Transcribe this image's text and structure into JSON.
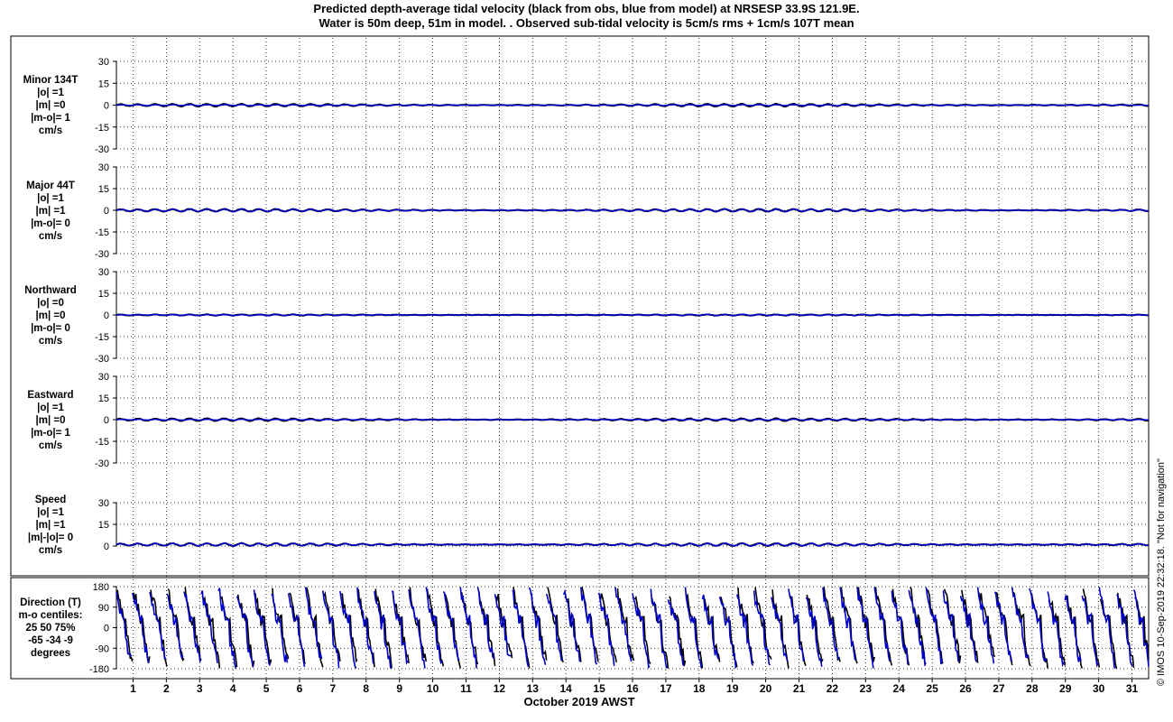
{
  "title_line1": "Predicted depth-average tidal velocity (black from obs, blue from model) at NRSESP 33.9S 121.9E.",
  "title_line2": "Water is 50m deep, 51m in model. . Observed sub-tidal velocity is 5cm/s rms + 1cm/s 107T mean",
  "x_axis_label": "October 2019 AWST",
  "footer": "© IMOS 10-Sep-2019 22:32:18.  \"Not for navigation\"",
  "colors": {
    "obs": "#000000",
    "model": "#0000cc",
    "grid": "#000000"
  },
  "chart_data": [
    {
      "type": "line",
      "panel": "minor",
      "label_lines": [
        "Minor 134T",
        "|o| =1",
        "|m| =0",
        "|m-o|= 1",
        "cm/s"
      ],
      "ylim": [
        -30,
        30
      ],
      "yticks": [
        30,
        15,
        0,
        -15,
        -30
      ],
      "xlim": [
        0.5,
        31.5
      ],
      "series": [
        {
          "name": "obs",
          "amplitude": 1,
          "mean": 0
        },
        {
          "name": "model",
          "amplitude": 0,
          "mean": 0
        }
      ]
    },
    {
      "type": "line",
      "panel": "major",
      "label_lines": [
        "Major 44T",
        "|o| =1",
        "|m| =1",
        "|m-o|= 0",
        "cm/s"
      ],
      "ylim": [
        -30,
        30
      ],
      "yticks": [
        30,
        15,
        0,
        -15,
        -30
      ],
      "xlim": [
        0.5,
        31.5
      ],
      "series": [
        {
          "name": "obs",
          "amplitude": 1,
          "mean": 0
        },
        {
          "name": "model",
          "amplitude": 1,
          "mean": 0
        }
      ]
    },
    {
      "type": "line",
      "panel": "northward",
      "label_lines": [
        "Northward",
        "|o| =0",
        "|m| =0",
        "|m-o|= 0",
        "cm/s"
      ],
      "ylim": [
        -30,
        30
      ],
      "yticks": [
        30,
        15,
        0,
        -15,
        -30
      ],
      "xlim": [
        0.5,
        31.5
      ],
      "series": [
        {
          "name": "obs",
          "amplitude": 0,
          "mean": 0
        },
        {
          "name": "model",
          "amplitude": 0,
          "mean": 0
        }
      ]
    },
    {
      "type": "line",
      "panel": "eastward",
      "label_lines": [
        "Eastward",
        "|o| =1",
        "|m| =0",
        "|m-o|= 1",
        "cm/s"
      ],
      "ylim": [
        -30,
        30
      ],
      "yticks": [
        30,
        15,
        0,
        -15,
        -30
      ],
      "xlim": [
        0.5,
        31.5
      ],
      "series": [
        {
          "name": "obs",
          "amplitude": 1,
          "mean": 0
        },
        {
          "name": "model",
          "amplitude": 0,
          "mean": 0
        }
      ]
    },
    {
      "type": "line",
      "panel": "speed",
      "label_lines": [
        "Speed",
        "|o| =1",
        "|m| =1",
        "|m|-|o|= 0",
        "cm/s"
      ],
      "ylim": [
        0,
        30
      ],
      "yticks": [
        30,
        15,
        0
      ],
      "xlim": [
        0.5,
        31.5
      ],
      "series": [
        {
          "name": "obs",
          "amplitude": 1,
          "mean": 1
        },
        {
          "name": "model",
          "amplitude": 1,
          "mean": 1
        }
      ]
    },
    {
      "type": "line",
      "panel": "direction",
      "label_lines": [
        "Direction (T)",
        "m-o centiles:",
        "25  50  75%",
        "-65 -34  -9",
        "degrees"
      ],
      "ylim": [
        -180,
        180
      ],
      "yticks": [
        180,
        90,
        0,
        -90,
        -180
      ],
      "xlim": [
        0.5,
        31.5
      ],
      "series": [
        {
          "name": "obs",
          "range": [
            -180,
            180
          ]
        },
        {
          "name": "model",
          "range": [
            -180,
            180
          ]
        }
      ]
    }
  ],
  "x_ticks": [
    "1",
    "2",
    "3",
    "4",
    "5",
    "6",
    "7",
    "8",
    "9",
    "10",
    "11",
    "12",
    "13",
    "14",
    "15",
    "16",
    "17",
    "18",
    "19",
    "20",
    "21",
    "22",
    "23",
    "24",
    "25",
    "26",
    "27",
    "28",
    "29",
    "30",
    "31"
  ]
}
